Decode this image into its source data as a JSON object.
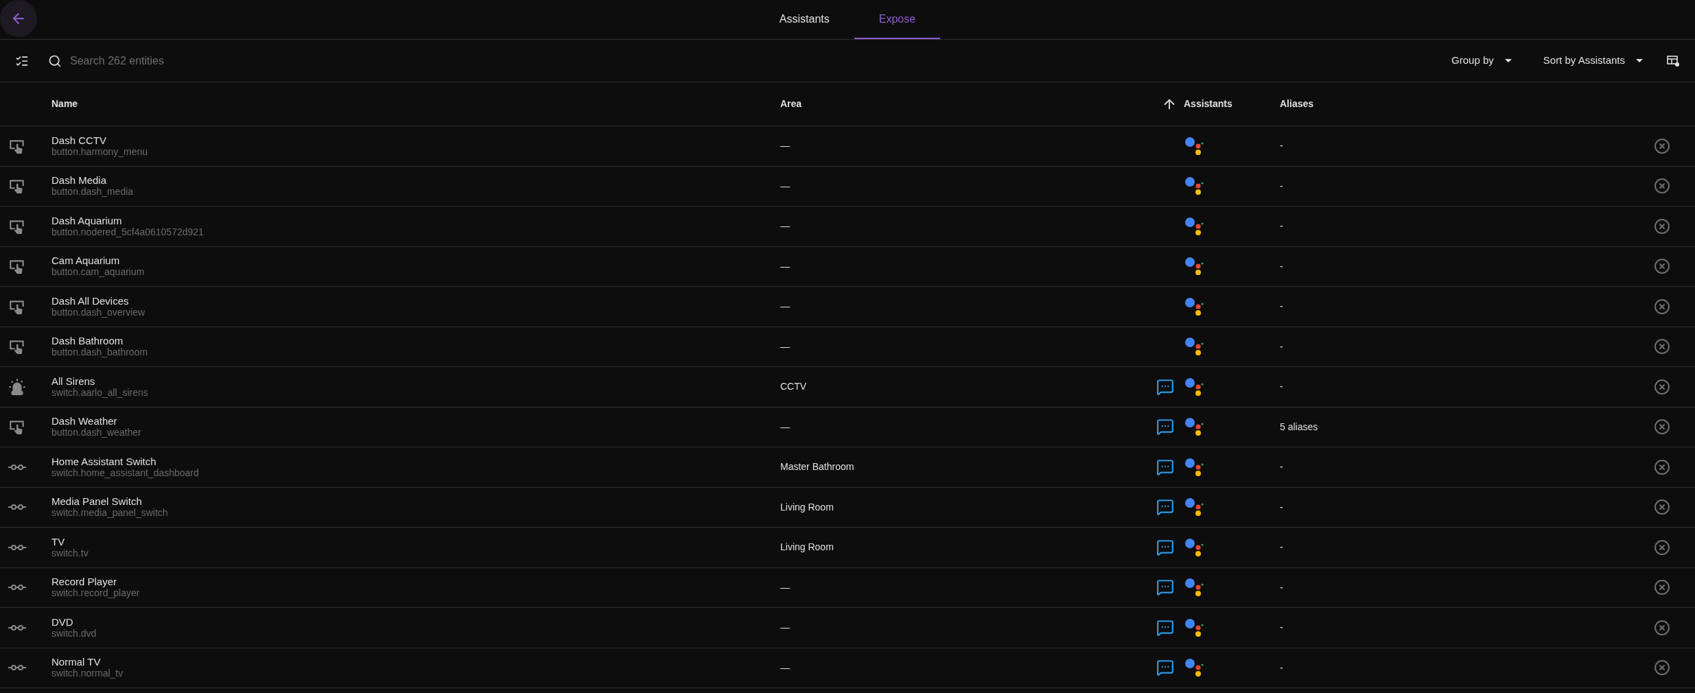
{
  "tabs": [
    {
      "label": "Assistants",
      "selected": false
    },
    {
      "label": "Expose",
      "selected": true
    }
  ],
  "search": {
    "placeholder": "Search 262 entities"
  },
  "toolbar": {
    "group_by": "Group by",
    "sort_by": "Sort by Assistants"
  },
  "columns": [
    {
      "label": "Name",
      "sorted": false
    },
    {
      "label": "Area",
      "sorted": false
    },
    {
      "label": "Assistants",
      "sorted": true
    },
    {
      "label": "Aliases",
      "sorted": false
    }
  ],
  "rows": [
    {
      "kind": "button",
      "name": "Dash CCTV",
      "entity_id": "button.harmony_menu",
      "area": "—",
      "assist": false,
      "google": true,
      "aliases": "-"
    },
    {
      "kind": "button",
      "name": "Dash Media",
      "entity_id": "button.dash_media",
      "area": "—",
      "assist": false,
      "google": true,
      "aliases": "-"
    },
    {
      "kind": "button",
      "name": "Dash Aquarium",
      "entity_id": "button.nodered_5cf4a0610572d921",
      "area": "—",
      "assist": false,
      "google": true,
      "aliases": "-"
    },
    {
      "kind": "button",
      "name": "Cam Aquarium",
      "entity_id": "button.cam_aquarium",
      "area": "—",
      "assist": false,
      "google": true,
      "aliases": "-"
    },
    {
      "kind": "button",
      "name": "Dash All Devices",
      "entity_id": "button.dash_overview",
      "area": "—",
      "assist": false,
      "google": true,
      "aliases": "-"
    },
    {
      "kind": "button",
      "name": "Dash Bathroom",
      "entity_id": "button.dash_bathroom",
      "area": "—",
      "assist": false,
      "google": true,
      "aliases": "-"
    },
    {
      "kind": "siren",
      "name": "All Sirens",
      "entity_id": "switch.aarlo_all_sirens",
      "area": "CCTV",
      "assist": true,
      "google": true,
      "aliases": "-"
    },
    {
      "kind": "button",
      "name": "Dash Weather",
      "entity_id": "button.dash_weather",
      "area": "—",
      "assist": true,
      "google": true,
      "aliases": "5 aliases"
    },
    {
      "kind": "switch",
      "name": "Home Assistant Switch",
      "entity_id": "switch.home_assistant_dashboard",
      "area": "Master Bathroom",
      "assist": true,
      "google": true,
      "aliases": "-"
    },
    {
      "kind": "switch",
      "name": "Media Panel Switch",
      "entity_id": "switch.media_panel_switch",
      "area": "Living Room",
      "assist": true,
      "google": true,
      "aliases": "-"
    },
    {
      "kind": "switch",
      "name": "TV",
      "entity_id": "switch.tv",
      "area": "Living Room",
      "assist": true,
      "google": true,
      "aliases": "-"
    },
    {
      "kind": "switch",
      "name": "Record Player",
      "entity_id": "switch.record_player",
      "area": "—",
      "assist": true,
      "google": true,
      "aliases": "-"
    },
    {
      "kind": "switch",
      "name": "DVD",
      "entity_id": "switch.dvd",
      "area": "—",
      "assist": true,
      "google": true,
      "aliases": "-"
    },
    {
      "kind": "switch",
      "name": "Normal TV",
      "entity_id": "switch.normal_tv",
      "area": "—",
      "assist": true,
      "google": true,
      "aliases": "-"
    }
  ]
}
